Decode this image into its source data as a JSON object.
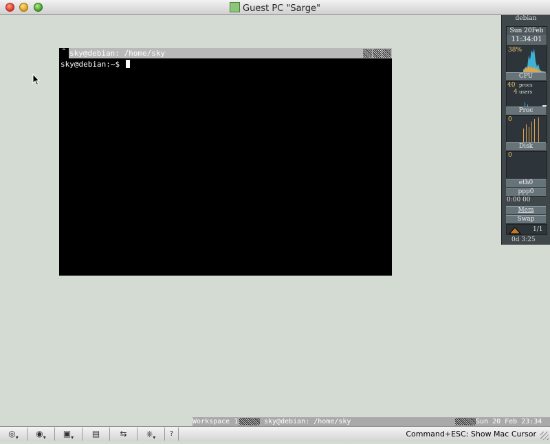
{
  "window": {
    "title": "Guest PC \"Sarge\""
  },
  "terminal": {
    "title": "sky@debian: /home/sky",
    "prompt": "sky@debian:~$ "
  },
  "dock": {
    "host": "debian",
    "date_line1": "Sun 20Feb",
    "time": "11:34:01",
    "cpu_percent": "38%",
    "cpu_label": "CPU",
    "procs_count": "40",
    "procs_label": "procs",
    "users_count": "4",
    "users_label": "users",
    "proc_label": "Proc",
    "proc_value": "0",
    "disk_label": "Disk",
    "disk_value": "0",
    "net1": "eth0",
    "net2": "ppp0",
    "net_time": "0:00 00",
    "mem_label": "Mem",
    "swap_label": "Swap",
    "pager": "1/1",
    "uptime": "0d 3:25"
  },
  "wm_status": {
    "workspace": "Workspace 1",
    "window": "sky@debian: /home/sky",
    "clock": "Sun 20 Feb 23:34"
  },
  "toolbar": {
    "hint": "Command+ESC: Show Mac Cursor",
    "help": "?"
  }
}
